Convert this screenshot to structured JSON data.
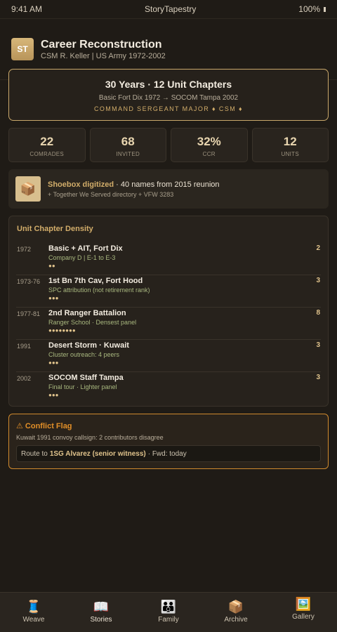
{
  "status": {
    "time": "9:41 AM",
    "app": "StoryTapestry",
    "battery": "100%"
  },
  "header": {
    "avatar": "ST",
    "title": "Career Reconstruction",
    "subtitle": "CSM R. Keller | US Army 1972-2002"
  },
  "hero": {
    "title": "30 Years · 12 Unit Chapters",
    "route": "Basic Fort Dix 1972 → SOCOM Tampa 2002",
    "rank": "COMMAND SERGEANT MAJOR ♦ CSM ♦"
  },
  "stats": [
    {
      "value": "22",
      "label": "COMRADES"
    },
    {
      "value": "68",
      "label": "INVITED"
    },
    {
      "value": "32%",
      "label": "CCR"
    },
    {
      "value": "12",
      "label": "UNITS"
    }
  ],
  "shoebox": {
    "icon": "📦",
    "strong": "Shoebox digitized",
    "text": " · 40 names from 2015 reunion",
    "sub": "+ Together We Served directory + VFW 3283"
  },
  "density": {
    "title": "Unit Chapter Density",
    "chapters": [
      {
        "year": "1972",
        "name": "Basic + AIT, Fort Dix",
        "sub": "Company D | E-1 to E-3",
        "dots": "●●",
        "count": "2"
      },
      {
        "year": "1973-76",
        "name": "1st Bn 7th Cav, Fort Hood",
        "sub": "SPC attribution (not retirement rank)",
        "dots": "●●●",
        "count": "3"
      },
      {
        "year": "1977-81",
        "name": "2nd Ranger Battalion",
        "sub": "Ranger School · Densest panel",
        "dots": "●●●●●●●●",
        "count": "8"
      },
      {
        "year": "1991",
        "name": "Desert Storm · Kuwait",
        "sub": "Cluster outreach: 4 peers",
        "dots": "●●●",
        "count": "3"
      },
      {
        "year": "2002",
        "name": "SOCOM Staff Tampa",
        "sub": "Final tour · Lighter panel",
        "dots": "●●●",
        "count": "3"
      }
    ]
  },
  "conflict": {
    "title": "⚠ Conflict Flag",
    "desc": "Kuwait 1991 convoy callsign: 2 contributors disagree",
    "route_prefix": "Route to",
    "route_strong": "1SG Alvarez (senior witness)",
    "route_suffix": "· Fwd: today"
  },
  "tabs": [
    {
      "icon": "🧵",
      "label": "Weave"
    },
    {
      "icon": "📖",
      "label": "Stories"
    },
    {
      "icon": "👪",
      "label": "Family"
    },
    {
      "icon": "📦",
      "label": "Archive"
    },
    {
      "icon": "🖼️",
      "label": "Gallery"
    }
  ]
}
